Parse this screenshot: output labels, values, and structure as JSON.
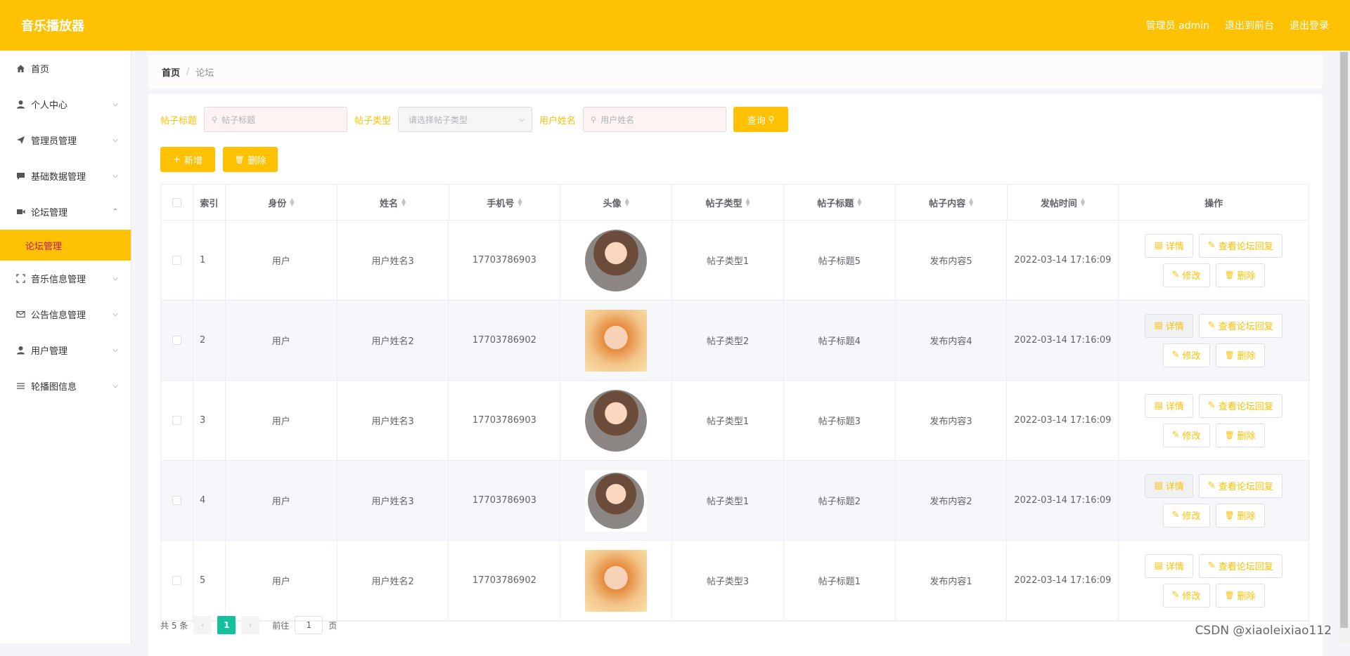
{
  "header": {
    "title": "音乐播放器",
    "admin": "管理员 admin",
    "to_front": "退出到前台",
    "logout": "退出登录"
  },
  "sidebar": {
    "items": [
      {
        "label": "首页",
        "icon": "home-icon"
      },
      {
        "label": "个人中心",
        "icon": "user-icon"
      },
      {
        "label": "管理员管理",
        "icon": "send-icon"
      },
      {
        "label": "基础数据管理",
        "icon": "chat-icon"
      },
      {
        "label": "论坛管理",
        "icon": "video-icon"
      },
      {
        "label": "音乐信息管理",
        "icon": "expand-icon"
      },
      {
        "label": "公告信息管理",
        "icon": "mail-icon"
      },
      {
        "label": "用户管理",
        "icon": "user-icon"
      },
      {
        "label": "轮播图信息",
        "icon": "list-icon"
      }
    ],
    "active_sub": "论坛管理"
  },
  "breadcrumb": {
    "home": "首页",
    "sep": "/",
    "current": "论坛"
  },
  "search": {
    "title_label": "帖子标题",
    "title_placeholder": "帖子标题",
    "type_label": "帖子类型",
    "type_placeholder": "请选择帖子类型",
    "user_label": "用户姓名",
    "user_placeholder": "用户姓名",
    "query": "查询"
  },
  "actions": {
    "add": "新增",
    "delete": "删除"
  },
  "columns": [
    "索引",
    "身份",
    "姓名",
    "手机号",
    "头像",
    "帖子类型",
    "帖子标题",
    "帖子内容",
    "发帖时间",
    "操作"
  ],
  "rows": [
    {
      "index": "1",
      "role": "用户",
      "name": "用户姓名3",
      "phone": "17703786903",
      "type": "帖子类型1",
      "title": "帖子标题5",
      "content": "发布内容5",
      "time": "2022-03-14 17:16:09"
    },
    {
      "index": "2",
      "role": "用户",
      "name": "用户姓名2",
      "phone": "17703786902",
      "type": "帖子类型2",
      "title": "帖子标题4",
      "content": "发布内容4",
      "time": "2022-03-14 17:16:09"
    },
    {
      "index": "3",
      "role": "用户",
      "name": "用户姓名3",
      "phone": "17703786903",
      "type": "帖子类型1",
      "title": "帖子标题3",
      "content": "发布内容3",
      "time": "2022-03-14 17:16:09"
    },
    {
      "index": "4",
      "role": "用户",
      "name": "用户姓名3",
      "phone": "17703786903",
      "type": "帖子类型1",
      "title": "帖子标题2",
      "content": "发布内容2",
      "time": "2022-03-14 17:16:09"
    },
    {
      "index": "5",
      "role": "用户",
      "name": "用户姓名2",
      "phone": "17703786902",
      "type": "帖子类型3",
      "title": "帖子标题1",
      "content": "发布内容1",
      "time": "2022-03-14 17:16:09"
    }
  ],
  "row_actions": {
    "detail": "详情",
    "reply": "查看论坛回复",
    "edit": "修改",
    "delete": "删除"
  },
  "pager": {
    "total": "共 5 条",
    "current": "1",
    "goto": "前往",
    "goto_value": "1",
    "page": "页"
  },
  "watermark": "CSDN @xiaoleixiao112",
  "colors": {
    "accent": "#fec103",
    "pager_active": "#13c29c"
  }
}
